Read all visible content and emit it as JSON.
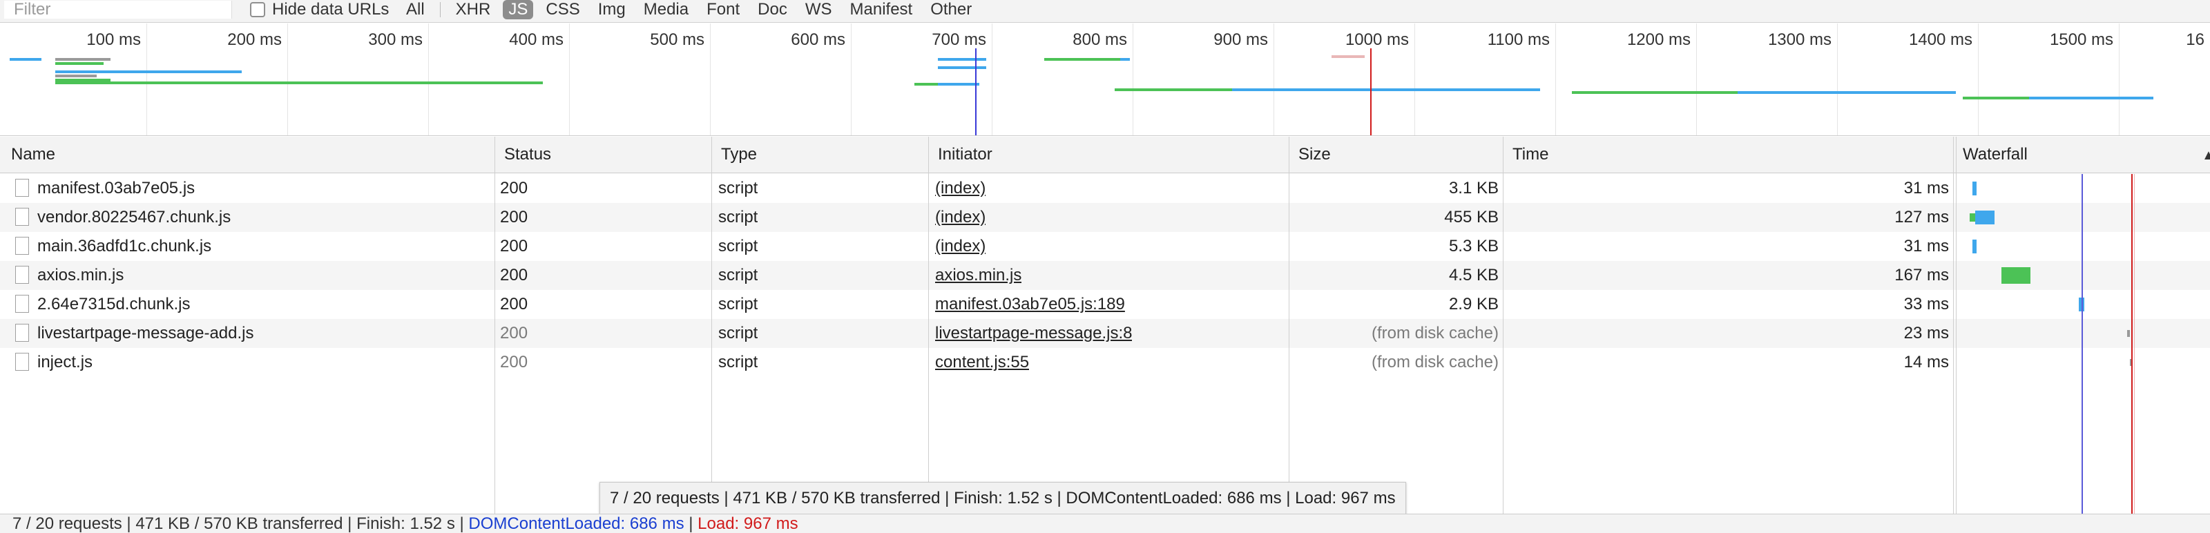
{
  "filter": {
    "placeholder": "Filter"
  },
  "hide_data_urls_label": "Hide data URLs",
  "type_filters": [
    "All",
    "XHR",
    "JS",
    "CSS",
    "Img",
    "Media",
    "Font",
    "Doc",
    "WS",
    "Manifest",
    "Other"
  ],
  "active_type": "JS",
  "overview": {
    "ticks": [
      "100 ms",
      "200 ms",
      "300 ms",
      "400 ms",
      "500 ms",
      "600 ms",
      "700 ms",
      "800 ms",
      "900 ms",
      "1000 ms",
      "1100 ms",
      "1200 ms",
      "1300 ms",
      "1400 ms",
      "1500 ms",
      "16"
    ]
  },
  "columns": {
    "name": "Name",
    "status": "Status",
    "type": "Type",
    "initiator": "Initiator",
    "size": "Size",
    "time": "Time",
    "waterfall": "Waterfall"
  },
  "rows": [
    {
      "name": "manifest.03ab7e05.js",
      "status": "200",
      "type": "script",
      "initiator": "(index)",
      "size": "3.1 KB",
      "time": "31 ms",
      "status_muted": false,
      "size_muted": false
    },
    {
      "name": "vendor.80225467.chunk.js",
      "status": "200",
      "type": "script",
      "initiator": "(index)",
      "size": "455 KB",
      "time": "127 ms",
      "status_muted": false,
      "size_muted": false
    },
    {
      "name": "main.36adfd1c.chunk.js",
      "status": "200",
      "type": "script",
      "initiator": "(index)",
      "size": "5.3 KB",
      "time": "31 ms",
      "status_muted": false,
      "size_muted": false
    },
    {
      "name": "axios.min.js",
      "status": "200",
      "type": "script",
      "initiator": "axios.min.js",
      "size": "4.5 KB",
      "time": "167 ms",
      "status_muted": false,
      "size_muted": false
    },
    {
      "name": "2.64e7315d.chunk.js",
      "status": "200",
      "type": "script",
      "initiator": "manifest.03ab7e05.js:189",
      "size": "2.9 KB",
      "time": "33 ms",
      "status_muted": false,
      "size_muted": false
    },
    {
      "name": "livestartpage-message-add.js",
      "status": "200",
      "type": "script",
      "initiator": "livestartpage-message.js:8",
      "size": "(from disk cache)",
      "time": "23 ms",
      "status_muted": true,
      "size_muted": true
    },
    {
      "name": "inject.js",
      "status": "200",
      "type": "script",
      "initiator": "content.js:55",
      "size": "(from disk cache)",
      "time": "14 ms",
      "status_muted": true,
      "size_muted": true
    }
  ],
  "tooltip": "7 / 20 requests | 471 KB / 570 KB transferred | Finish: 1.52 s | DOMContentLoaded: 686 ms | Load: 967 ms",
  "status": {
    "summary": "7 / 20 requests | 471 KB / 570 KB transferred | Finish: 1.52 s | ",
    "dom": "DOMContentLoaded: 686 ms",
    "sep": " | ",
    "load": "Load: 967 ms"
  },
  "colors": {
    "dom_line": "#3a3ad8",
    "load_line": "#d11b1b",
    "green": "#4cc256",
    "blue": "#3fa7ec"
  }
}
